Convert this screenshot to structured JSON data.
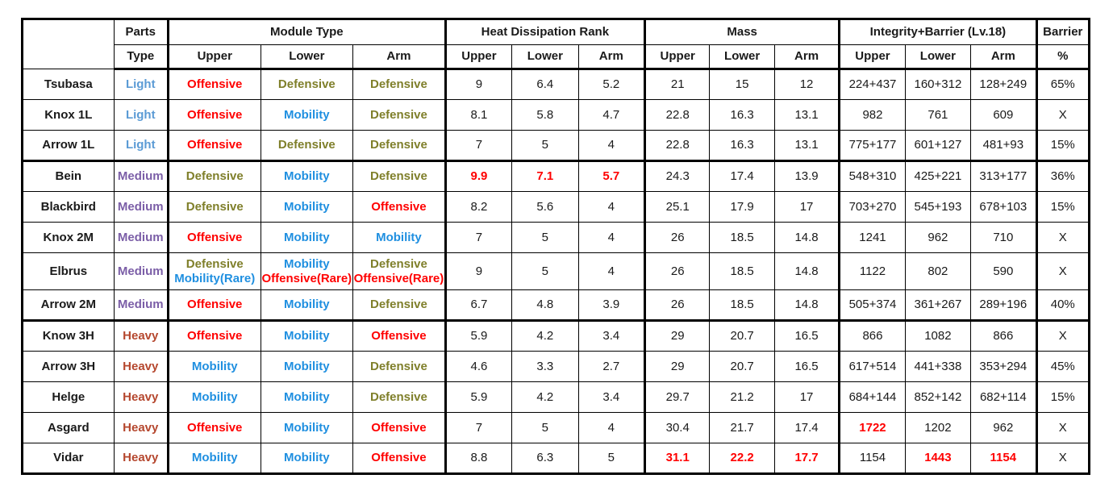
{
  "table": {
    "header": {
      "corner": "",
      "parts_type": {
        "line1": "Parts",
        "line2": "Type"
      },
      "groups": [
        {
          "label": "Module Type",
          "sub": [
            "Upper",
            "Lower",
            "Arm"
          ]
        },
        {
          "label": "Heat Dissipation Rank",
          "sub": [
            "Upper",
            "Lower",
            "Arm"
          ]
        },
        {
          "label": "Mass",
          "sub": [
            "Upper",
            "Lower",
            "Arm"
          ]
        },
        {
          "label": "Integrity+Barrier (Lv.18)",
          "sub": [
            "Upper",
            "Lower",
            "Arm"
          ]
        }
      ],
      "barrier": {
        "line1": "Barrier",
        "line2": "%"
      }
    },
    "colors": {
      "light": "#5B9BD5",
      "medium": "#7B5EA7",
      "heavy": "#B5472E",
      "offensive": "#FF0000",
      "defensive": "#7F7F2A",
      "mobility": "#1F8FE0",
      "highlight": "#FF0000",
      "text": "#1a1a1a",
      "border": "#000000"
    },
    "rows": [
      {
        "name": "Tsubasa",
        "parts_type": {
          "text": "Light",
          "color": "light"
        },
        "module": {
          "upper": [
            {
              "text": "Offensive",
              "color": "offensive"
            }
          ],
          "lower": [
            {
              "text": "Defensive",
              "color": "defensive"
            }
          ],
          "arm": [
            {
              "text": "Defensive",
              "color": "defensive"
            }
          ]
        },
        "heat": {
          "upper": "9",
          "lower": "6.4",
          "arm": "5.2"
        },
        "heat_hl": false,
        "mass": {
          "upper": "21",
          "lower": "15",
          "arm": "12"
        },
        "mass_hl": [
          false,
          false,
          false
        ],
        "integrity": {
          "upper": "224+437",
          "lower": "160+312",
          "arm": "128+249"
        },
        "integrity_hl": [
          false,
          false,
          false
        ],
        "barrier": "65%"
      },
      {
        "name": "Knox 1L",
        "parts_type": {
          "text": "Light",
          "color": "light"
        },
        "module": {
          "upper": [
            {
              "text": "Offensive",
              "color": "offensive"
            }
          ],
          "lower": [
            {
              "text": "Mobility",
              "color": "mobility"
            }
          ],
          "arm": [
            {
              "text": "Defensive",
              "color": "defensive"
            }
          ]
        },
        "heat": {
          "upper": "8.1",
          "lower": "5.8",
          "arm": "4.7"
        },
        "heat_hl": false,
        "mass": {
          "upper": "22.8",
          "lower": "16.3",
          "arm": "13.1"
        },
        "mass_hl": [
          false,
          false,
          false
        ],
        "integrity": {
          "upper": "982",
          "lower": "761",
          "arm": "609"
        },
        "integrity_hl": [
          false,
          false,
          false
        ],
        "barrier": "X"
      },
      {
        "name": "Arrow 1L",
        "parts_type": {
          "text": "Light",
          "color": "light"
        },
        "module": {
          "upper": [
            {
              "text": "Offensive",
              "color": "offensive"
            }
          ],
          "lower": [
            {
              "text": "Defensive",
              "color": "defensive"
            }
          ],
          "arm": [
            {
              "text": "Defensive",
              "color": "defensive"
            }
          ]
        },
        "heat": {
          "upper": "7",
          "lower": "5",
          "arm": "4"
        },
        "heat_hl": false,
        "mass": {
          "upper": "22.8",
          "lower": "16.3",
          "arm": "13.1"
        },
        "mass_hl": [
          false,
          false,
          false
        ],
        "integrity": {
          "upper": "775+177",
          "lower": "601+127",
          "arm": "481+93"
        },
        "integrity_hl": [
          false,
          false,
          false
        ],
        "barrier": "15%",
        "group_end": true
      },
      {
        "name": "Bein",
        "parts_type": {
          "text": "Medium",
          "color": "medium"
        },
        "module": {
          "upper": [
            {
              "text": "Defensive",
              "color": "defensive"
            }
          ],
          "lower": [
            {
              "text": "Mobility",
              "color": "mobility"
            }
          ],
          "arm": [
            {
              "text": "Defensive",
              "color": "defensive"
            }
          ]
        },
        "heat": {
          "upper": "9.9",
          "lower": "7.1",
          "arm": "5.7"
        },
        "heat_hl": true,
        "mass": {
          "upper": "24.3",
          "lower": "17.4",
          "arm": "13.9"
        },
        "mass_hl": [
          false,
          false,
          false
        ],
        "integrity": {
          "upper": "548+310",
          "lower": "425+221",
          "arm": "313+177"
        },
        "integrity_hl": [
          false,
          false,
          false
        ],
        "barrier": "36%"
      },
      {
        "name": "Blackbird",
        "parts_type": {
          "text": "Medium",
          "color": "medium"
        },
        "module": {
          "upper": [
            {
              "text": "Defensive",
              "color": "defensive"
            }
          ],
          "lower": [
            {
              "text": "Mobility",
              "color": "mobility"
            }
          ],
          "arm": [
            {
              "text": "Offensive",
              "color": "offensive"
            }
          ]
        },
        "heat": {
          "upper": "8.2",
          "lower": "5.6",
          "arm": "4"
        },
        "heat_hl": false,
        "mass": {
          "upper": "25.1",
          "lower": "17.9",
          "arm": "17"
        },
        "mass_hl": [
          false,
          false,
          false
        ],
        "integrity": {
          "upper": "703+270",
          "lower": "545+193",
          "arm": "678+103"
        },
        "integrity_hl": [
          false,
          false,
          false
        ],
        "barrier": "15%"
      },
      {
        "name": "Knox 2M",
        "parts_type": {
          "text": "Medium",
          "color": "medium"
        },
        "module": {
          "upper": [
            {
              "text": "Offensive",
              "color": "offensive"
            }
          ],
          "lower": [
            {
              "text": "Mobility",
              "color": "mobility"
            }
          ],
          "arm": [
            {
              "text": "Mobility",
              "color": "mobility"
            }
          ]
        },
        "heat": {
          "upper": "7",
          "lower": "5",
          "arm": "4"
        },
        "heat_hl": false,
        "mass": {
          "upper": "26",
          "lower": "18.5",
          "arm": "14.8"
        },
        "mass_hl": [
          false,
          false,
          false
        ],
        "integrity": {
          "upper": "1241",
          "lower": "962",
          "arm": "710"
        },
        "integrity_hl": [
          false,
          false,
          false
        ],
        "barrier": "X"
      },
      {
        "name": "Elbrus",
        "parts_type": {
          "text": "Medium",
          "color": "medium"
        },
        "module": {
          "upper": [
            {
              "text": "Defensive",
              "color": "defensive"
            },
            {
              "text": "Mobility(Rare)",
              "color": "mobility"
            }
          ],
          "lower": [
            {
              "text": "Mobility",
              "color": "mobility"
            },
            {
              "text": "Offensive(Rare)",
              "color": "offensive"
            }
          ],
          "arm": [
            {
              "text": "Defensive",
              "color": "defensive"
            },
            {
              "text": "Offensive(Rare)",
              "color": "offensive"
            }
          ]
        },
        "heat": {
          "upper": "9",
          "lower": "5",
          "arm": "4"
        },
        "heat_hl": false,
        "mass": {
          "upper": "26",
          "lower": "18.5",
          "arm": "14.8"
        },
        "mass_hl": [
          false,
          false,
          false
        ],
        "integrity": {
          "upper": "1122",
          "lower": "802",
          "arm": "590"
        },
        "integrity_hl": [
          false,
          false,
          false
        ],
        "barrier": "X",
        "tall": true
      },
      {
        "name": "Arrow 2M",
        "parts_type": {
          "text": "Medium",
          "color": "medium"
        },
        "module": {
          "upper": [
            {
              "text": "Offensive",
              "color": "offensive"
            }
          ],
          "lower": [
            {
              "text": "Mobility",
              "color": "mobility"
            }
          ],
          "arm": [
            {
              "text": "Defensive",
              "color": "defensive"
            }
          ]
        },
        "heat": {
          "upper": "6.7",
          "lower": "4.8",
          "arm": "3.9"
        },
        "heat_hl": false,
        "mass": {
          "upper": "26",
          "lower": "18.5",
          "arm": "14.8"
        },
        "mass_hl": [
          false,
          false,
          false
        ],
        "integrity": {
          "upper": "505+374",
          "lower": "361+267",
          "arm": "289+196"
        },
        "integrity_hl": [
          false,
          false,
          false
        ],
        "barrier": "40%",
        "group_end": true
      },
      {
        "name": "Know 3H",
        "parts_type": {
          "text": "Heavy",
          "color": "heavy"
        },
        "module": {
          "upper": [
            {
              "text": "Offensive",
              "color": "offensive"
            }
          ],
          "lower": [
            {
              "text": "Mobility",
              "color": "mobility"
            }
          ],
          "arm": [
            {
              "text": "Offensive",
              "color": "offensive"
            }
          ]
        },
        "heat": {
          "upper": "5.9",
          "lower": "4.2",
          "arm": "3.4"
        },
        "heat_hl": false,
        "mass": {
          "upper": "29",
          "lower": "20.7",
          "arm": "16.5"
        },
        "mass_hl": [
          false,
          false,
          false
        ],
        "integrity": {
          "upper": "866",
          "lower": "1082",
          "arm": "866"
        },
        "integrity_hl": [
          false,
          false,
          false
        ],
        "barrier": "X"
      },
      {
        "name": "Arrow 3H",
        "parts_type": {
          "text": "Heavy",
          "color": "heavy"
        },
        "module": {
          "upper": [
            {
              "text": "Mobility",
              "color": "mobility"
            }
          ],
          "lower": [
            {
              "text": "Mobility",
              "color": "mobility"
            }
          ],
          "arm": [
            {
              "text": "Defensive",
              "color": "defensive"
            }
          ]
        },
        "heat": {
          "upper": "4.6",
          "lower": "3.3",
          "arm": "2.7"
        },
        "heat_hl": false,
        "mass": {
          "upper": "29",
          "lower": "20.7",
          "arm": "16.5"
        },
        "mass_hl": [
          false,
          false,
          false
        ],
        "integrity": {
          "upper": "617+514",
          "lower": "441+338",
          "arm": "353+294"
        },
        "integrity_hl": [
          false,
          false,
          false
        ],
        "barrier": "45%"
      },
      {
        "name": "Helge",
        "parts_type": {
          "text": "Heavy",
          "color": "heavy"
        },
        "module": {
          "upper": [
            {
              "text": "Mobility",
              "color": "mobility"
            }
          ],
          "lower": [
            {
              "text": "Mobility",
              "color": "mobility"
            }
          ],
          "arm": [
            {
              "text": "Defensive",
              "color": "defensive"
            }
          ]
        },
        "heat": {
          "upper": "5.9",
          "lower": "4.2",
          "arm": "3.4"
        },
        "heat_hl": false,
        "mass": {
          "upper": "29.7",
          "lower": "21.2",
          "arm": "17"
        },
        "mass_hl": [
          false,
          false,
          false
        ],
        "integrity": {
          "upper": "684+144",
          "lower": "852+142",
          "arm": "682+114"
        },
        "integrity_hl": [
          false,
          false,
          false
        ],
        "barrier": "15%"
      },
      {
        "name": "Asgard",
        "parts_type": {
          "text": "Heavy",
          "color": "heavy"
        },
        "module": {
          "upper": [
            {
              "text": "Offensive",
              "color": "offensive"
            }
          ],
          "lower": [
            {
              "text": "Mobility",
              "color": "mobility"
            }
          ],
          "arm": [
            {
              "text": "Offensive",
              "color": "offensive"
            }
          ]
        },
        "heat": {
          "upper": "7",
          "lower": "5",
          "arm": "4"
        },
        "heat_hl": false,
        "mass": {
          "upper": "30.4",
          "lower": "21.7",
          "arm": "17.4"
        },
        "mass_hl": [
          false,
          false,
          false
        ],
        "integrity": {
          "upper": "1722",
          "lower": "1202",
          "arm": "962"
        },
        "integrity_hl": [
          true,
          false,
          false
        ],
        "barrier": "X"
      },
      {
        "name": "Vidar",
        "parts_type": {
          "text": "Heavy",
          "color": "heavy"
        },
        "module": {
          "upper": [
            {
              "text": "Mobility",
              "color": "mobility"
            }
          ],
          "lower": [
            {
              "text": "Mobility",
              "color": "mobility"
            }
          ],
          "arm": [
            {
              "text": "Offensive",
              "color": "offensive"
            }
          ]
        },
        "heat": {
          "upper": "8.8",
          "lower": "6.3",
          "arm": "5"
        },
        "heat_hl": false,
        "mass": {
          "upper": "31.1",
          "lower": "22.2",
          "arm": "17.7"
        },
        "mass_hl": [
          true,
          true,
          true
        ],
        "integrity": {
          "upper": "1154",
          "lower": "1443",
          "arm": "1154"
        },
        "integrity_hl": [
          false,
          true,
          true
        ],
        "barrier": "X"
      }
    ]
  }
}
